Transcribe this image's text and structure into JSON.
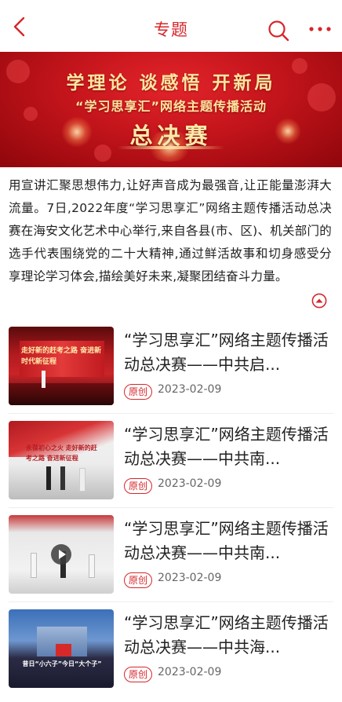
{
  "header": {
    "title": "专题"
  },
  "banner": {
    "line1": "学理论 谈感悟 开新局",
    "line2": "“学习思享汇”网络主题传播活动",
    "line3": "总决赛"
  },
  "intro": {
    "text": "用宣讲汇聚思想伟力,让好声音成为最强音,让正能量澎湃大流量。7日,2022年度“学习思享汇”网络主题传播活动总决赛在海安文化艺术中心举行,来自各县(市、区)、机关部门的选手代表围绕党的二十大精神,通过鲜活故事和切身感受分享理论学习体会,描绘美好未来,凝聚团结奋斗力量。"
  },
  "articles": [
    {
      "title": "“学习思享汇”网络主题传播活动总决赛——中共启...",
      "badge": "原创",
      "date": "2023-02-09",
      "thumb_text": "走好新的赶考之路 奋进新时代新征程"
    },
    {
      "title": "“学习思享汇”网络主题传播活动总决赛——中共南...",
      "badge": "原创",
      "date": "2023-02-09",
      "thumb_text": "永葆初心之火 走好新的赶考之路 奋进新征程"
    },
    {
      "title": "“学习思享汇”网络主题传播活动总决赛——中共南...",
      "badge": "原创",
      "date": "2023-02-09",
      "thumb_text": ""
    },
    {
      "title": "“学习思享汇”网络主题传播活动总决赛——中共海...",
      "badge": "原创",
      "date": "2023-02-09",
      "thumb_text": "昔日“小六子”今日“大个子”"
    }
  ],
  "colors": {
    "accent": "#d6262b",
    "text": "#222222",
    "muted": "#666666"
  },
  "icons": [
    "back-arrow-icon",
    "search-icon",
    "more-icon",
    "collapse-arrow-icon",
    "play-icon"
  ]
}
